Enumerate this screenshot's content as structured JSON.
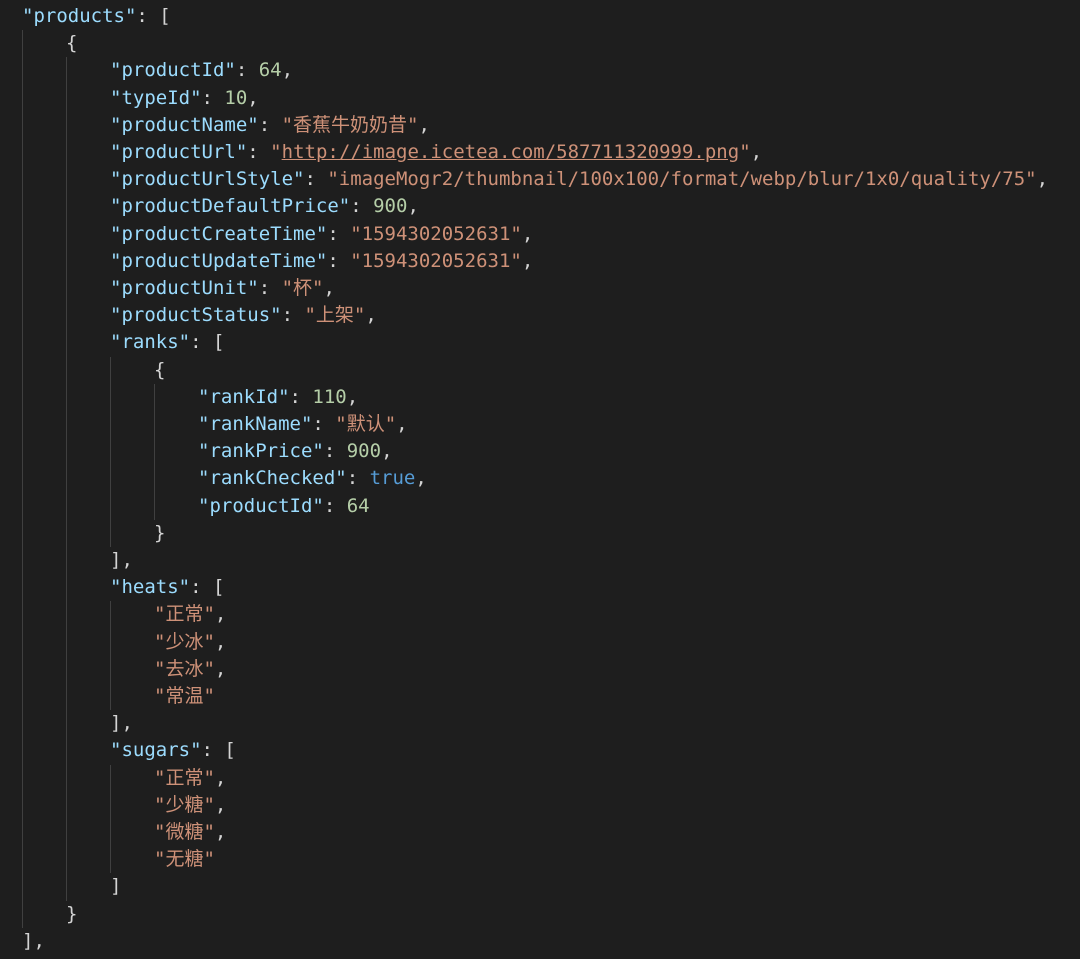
{
  "lines": [
    {
      "indent": 0,
      "tokens": [
        [
          "k",
          "\"products\""
        ],
        [
          "p",
          ": ["
        ]
      ]
    },
    {
      "indent": 1,
      "tokens": [
        [
          "p",
          "{"
        ]
      ]
    },
    {
      "indent": 2,
      "tokens": [
        [
          "k",
          "\"productId\""
        ],
        [
          "p",
          ": "
        ],
        [
          "n",
          "64"
        ],
        [
          "p",
          ","
        ]
      ]
    },
    {
      "indent": 2,
      "tokens": [
        [
          "k",
          "\"typeId\""
        ],
        [
          "p",
          ": "
        ],
        [
          "n",
          "10"
        ],
        [
          "p",
          ","
        ]
      ]
    },
    {
      "indent": 2,
      "tokens": [
        [
          "k",
          "\"productName\""
        ],
        [
          "p",
          ": "
        ],
        [
          "s",
          "\"香蕉牛奶奶昔\""
        ],
        [
          "p",
          ","
        ]
      ]
    },
    {
      "indent": 2,
      "tokens": [
        [
          "k",
          "\"productUrl\""
        ],
        [
          "p",
          ": "
        ],
        [
          "s",
          "\""
        ],
        [
          "u",
          "http://image.icetea.com/587711320999.png"
        ],
        [
          "s",
          "\""
        ],
        [
          "p",
          ","
        ]
      ]
    },
    {
      "indent": 2,
      "tokens": [
        [
          "k",
          "\"productUrlStyle\""
        ],
        [
          "p",
          ": "
        ],
        [
          "s",
          "\"imageMogr2/thumbnail/100x100/format/webp/blur/1x0/quality/75\""
        ],
        [
          "p",
          ","
        ]
      ]
    },
    {
      "indent": 2,
      "tokens": [
        [
          "k",
          "\"productDefaultPrice\""
        ],
        [
          "p",
          ": "
        ],
        [
          "n",
          "900"
        ],
        [
          "p",
          ","
        ]
      ]
    },
    {
      "indent": 2,
      "tokens": [
        [
          "k",
          "\"productCreateTime\""
        ],
        [
          "p",
          ": "
        ],
        [
          "s",
          "\"1594302052631\""
        ],
        [
          "p",
          ","
        ]
      ]
    },
    {
      "indent": 2,
      "tokens": [
        [
          "k",
          "\"productUpdateTime\""
        ],
        [
          "p",
          ": "
        ],
        [
          "s",
          "\"1594302052631\""
        ],
        [
          "p",
          ","
        ]
      ]
    },
    {
      "indent": 2,
      "tokens": [
        [
          "k",
          "\"productUnit\""
        ],
        [
          "p",
          ": "
        ],
        [
          "s",
          "\"杯\""
        ],
        [
          "p",
          ","
        ]
      ]
    },
    {
      "indent": 2,
      "tokens": [
        [
          "k",
          "\"productStatus\""
        ],
        [
          "p",
          ": "
        ],
        [
          "s",
          "\"上架\""
        ],
        [
          "p",
          ","
        ]
      ]
    },
    {
      "indent": 2,
      "tokens": [
        [
          "k",
          "\"ranks\""
        ],
        [
          "p",
          ": ["
        ]
      ]
    },
    {
      "indent": 3,
      "tokens": [
        [
          "p",
          "{"
        ]
      ]
    },
    {
      "indent": 4,
      "tokens": [
        [
          "k",
          "\"rankId\""
        ],
        [
          "p",
          ": "
        ],
        [
          "n",
          "110"
        ],
        [
          "p",
          ","
        ]
      ]
    },
    {
      "indent": 4,
      "tokens": [
        [
          "k",
          "\"rankName\""
        ],
        [
          "p",
          ": "
        ],
        [
          "s",
          "\"默认\""
        ],
        [
          "p",
          ","
        ]
      ]
    },
    {
      "indent": 4,
      "tokens": [
        [
          "k",
          "\"rankPrice\""
        ],
        [
          "p",
          ": "
        ],
        [
          "n",
          "900"
        ],
        [
          "p",
          ","
        ]
      ]
    },
    {
      "indent": 4,
      "tokens": [
        [
          "k",
          "\"rankChecked\""
        ],
        [
          "p",
          ": "
        ],
        [
          "b",
          "true"
        ],
        [
          "p",
          ","
        ]
      ]
    },
    {
      "indent": 4,
      "tokens": [
        [
          "k",
          "\"productId\""
        ],
        [
          "p",
          ": "
        ],
        [
          "n",
          "64"
        ]
      ]
    },
    {
      "indent": 3,
      "tokens": [
        [
          "p",
          "}"
        ]
      ]
    },
    {
      "indent": 2,
      "tokens": [
        [
          "p",
          "],"
        ]
      ]
    },
    {
      "indent": 2,
      "tokens": [
        [
          "k",
          "\"heats\""
        ],
        [
          "p",
          ": ["
        ]
      ]
    },
    {
      "indent": 3,
      "tokens": [
        [
          "s",
          "\"正常\""
        ],
        [
          "p",
          ","
        ]
      ]
    },
    {
      "indent": 3,
      "tokens": [
        [
          "s",
          "\"少冰\""
        ],
        [
          "p",
          ","
        ]
      ]
    },
    {
      "indent": 3,
      "tokens": [
        [
          "s",
          "\"去冰\""
        ],
        [
          "p",
          ","
        ]
      ]
    },
    {
      "indent": 3,
      "tokens": [
        [
          "s",
          "\"常温\""
        ]
      ]
    },
    {
      "indent": 2,
      "tokens": [
        [
          "p",
          "],"
        ]
      ]
    },
    {
      "indent": 2,
      "tokens": [
        [
          "k",
          "\"sugars\""
        ],
        [
          "p",
          ": ["
        ]
      ]
    },
    {
      "indent": 3,
      "tokens": [
        [
          "s",
          "\"正常\""
        ],
        [
          "p",
          ","
        ]
      ]
    },
    {
      "indent": 3,
      "tokens": [
        [
          "s",
          "\"少糖\""
        ],
        [
          "p",
          ","
        ]
      ]
    },
    {
      "indent": 3,
      "tokens": [
        [
          "s",
          "\"微糖\""
        ],
        [
          "p",
          ","
        ]
      ]
    },
    {
      "indent": 3,
      "tokens": [
        [
          "s",
          "\"无糖\""
        ]
      ]
    },
    {
      "indent": 2,
      "tokens": [
        [
          "p",
          "]"
        ]
      ]
    },
    {
      "indent": 1,
      "tokens": [
        [
          "p",
          "}"
        ]
      ]
    },
    {
      "indent": 0,
      "tokens": [
        [
          "p",
          "],"
        ]
      ]
    }
  ]
}
